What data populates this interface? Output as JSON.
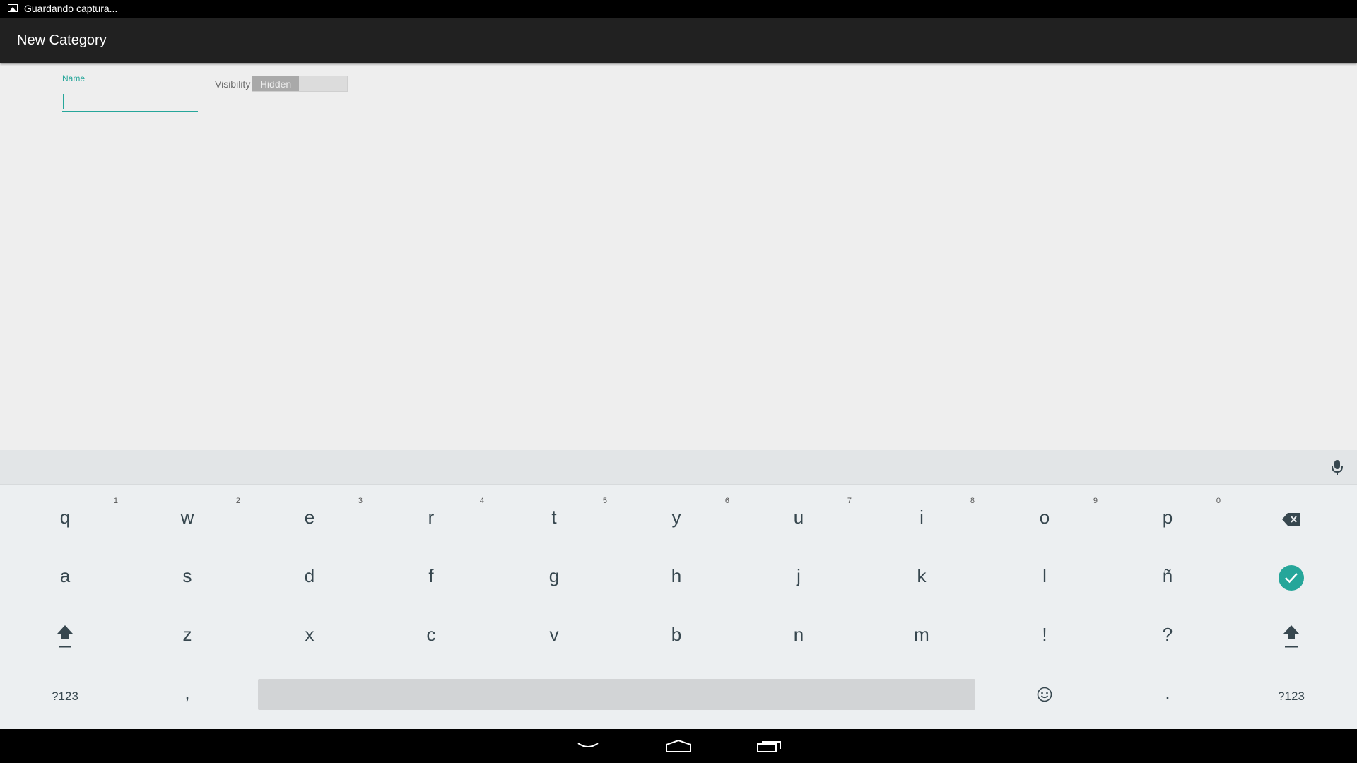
{
  "status_bar": {
    "notification_icon": "image-icon",
    "notification_text": "Guardando captura..."
  },
  "action_bar": {
    "title": "New Category"
  },
  "form": {
    "name_label": "Name",
    "name_value": "",
    "visibility_label": "Visibility",
    "visibility_state": "Hidden"
  },
  "keyboard": {
    "row1": [
      {
        "key": "q",
        "hint": "1"
      },
      {
        "key": "w",
        "hint": "2"
      },
      {
        "key": "e",
        "hint": "3"
      },
      {
        "key": "r",
        "hint": "4"
      },
      {
        "key": "t",
        "hint": "5"
      },
      {
        "key": "y",
        "hint": "6"
      },
      {
        "key": "u",
        "hint": "7"
      },
      {
        "key": "i",
        "hint": "8"
      },
      {
        "key": "o",
        "hint": "9"
      },
      {
        "key": "p",
        "hint": "0"
      }
    ],
    "row2": [
      "a",
      "s",
      "d",
      "f",
      "g",
      "h",
      "j",
      "k",
      "l",
      "ñ"
    ],
    "row3": [
      "z",
      "x",
      "c",
      "v",
      "b",
      "n",
      "m",
      "!",
      "?"
    ],
    "symbols_left": "?123",
    "comma": ",",
    "period": ".",
    "symbols_right": "?123",
    "accent_color": "#26a69a"
  },
  "nav_bar": {
    "icons": [
      "back-icon",
      "home-icon",
      "recents-icon"
    ]
  }
}
